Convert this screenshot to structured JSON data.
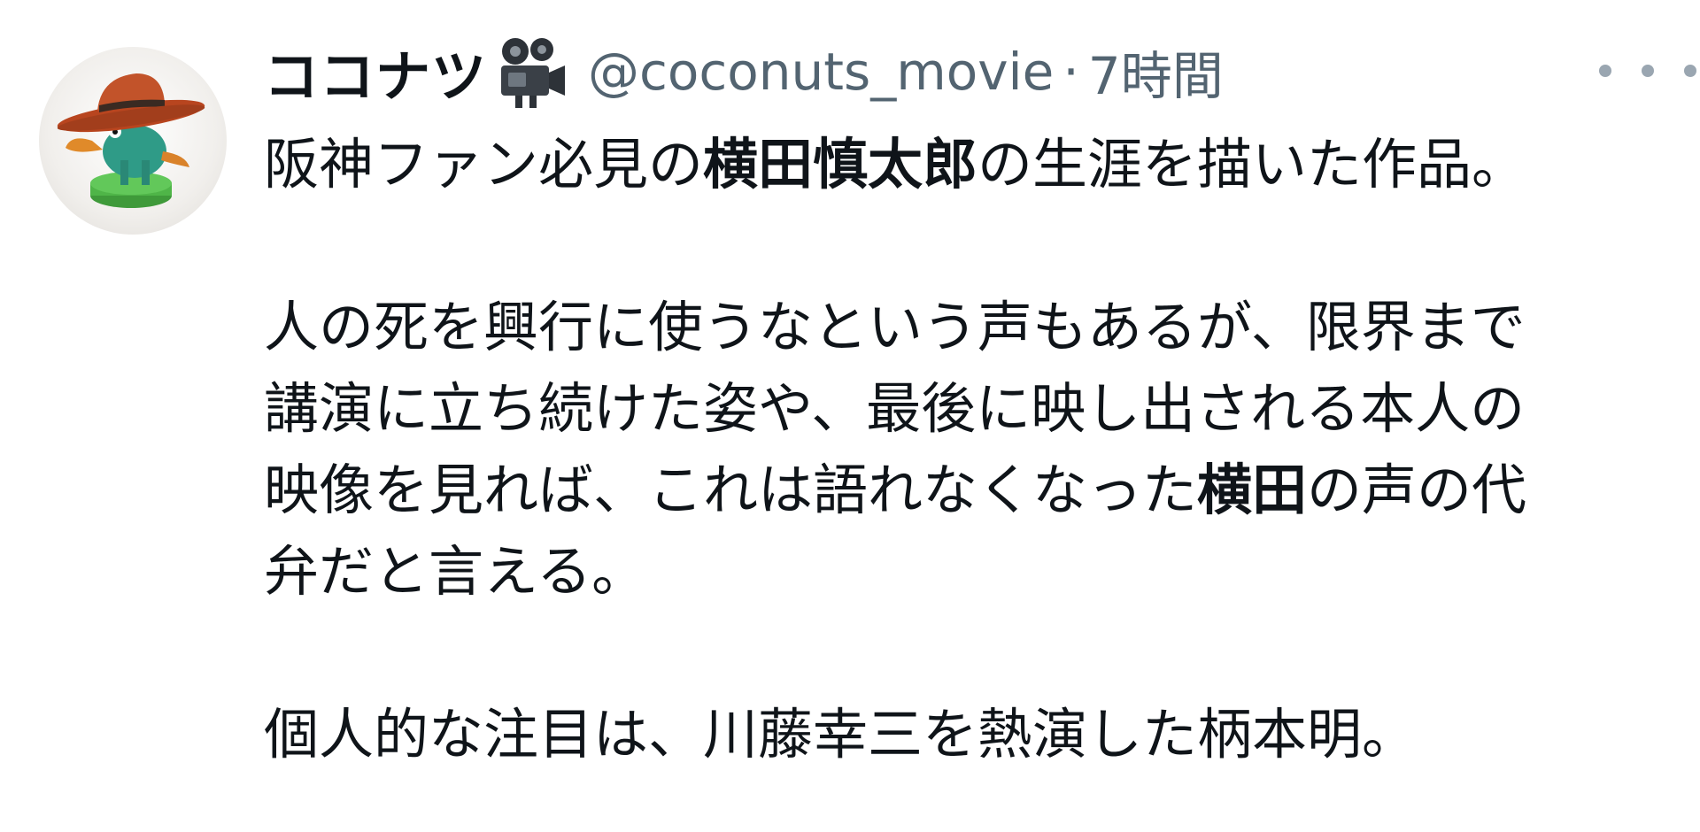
{
  "tweet": {
    "display_name": "ココナツ",
    "name_emoji_icon": "movie-camera-icon",
    "handle": "@coconuts_movie",
    "separator": "·",
    "time": "7時間",
    "more_icon": "more-dots-icon",
    "avatar_icon": "platypus-cowboy-hat-figure",
    "text": {
      "l1a": "阪神ファン必見の",
      "l1b": "横田慎太郎",
      "l1c": "の生涯を描いた作品。",
      "l2": "人の死を興行に使うなという声もあるが、限界まで",
      "l3": "講演に立ち続けた姿や、最後に映し出される本人の",
      "l4a": "映像を見れば、これは語れなくなった",
      "l4b": "横田",
      "l4c": "の声の代",
      "l5": "弁だと言える。",
      "l6": "個人的な注目は、川藤幸三を熱演した柄本明。"
    }
  },
  "colors": {
    "text": "#0f1419",
    "secondary": "#536471",
    "more_dots": "#9aa6b1"
  }
}
